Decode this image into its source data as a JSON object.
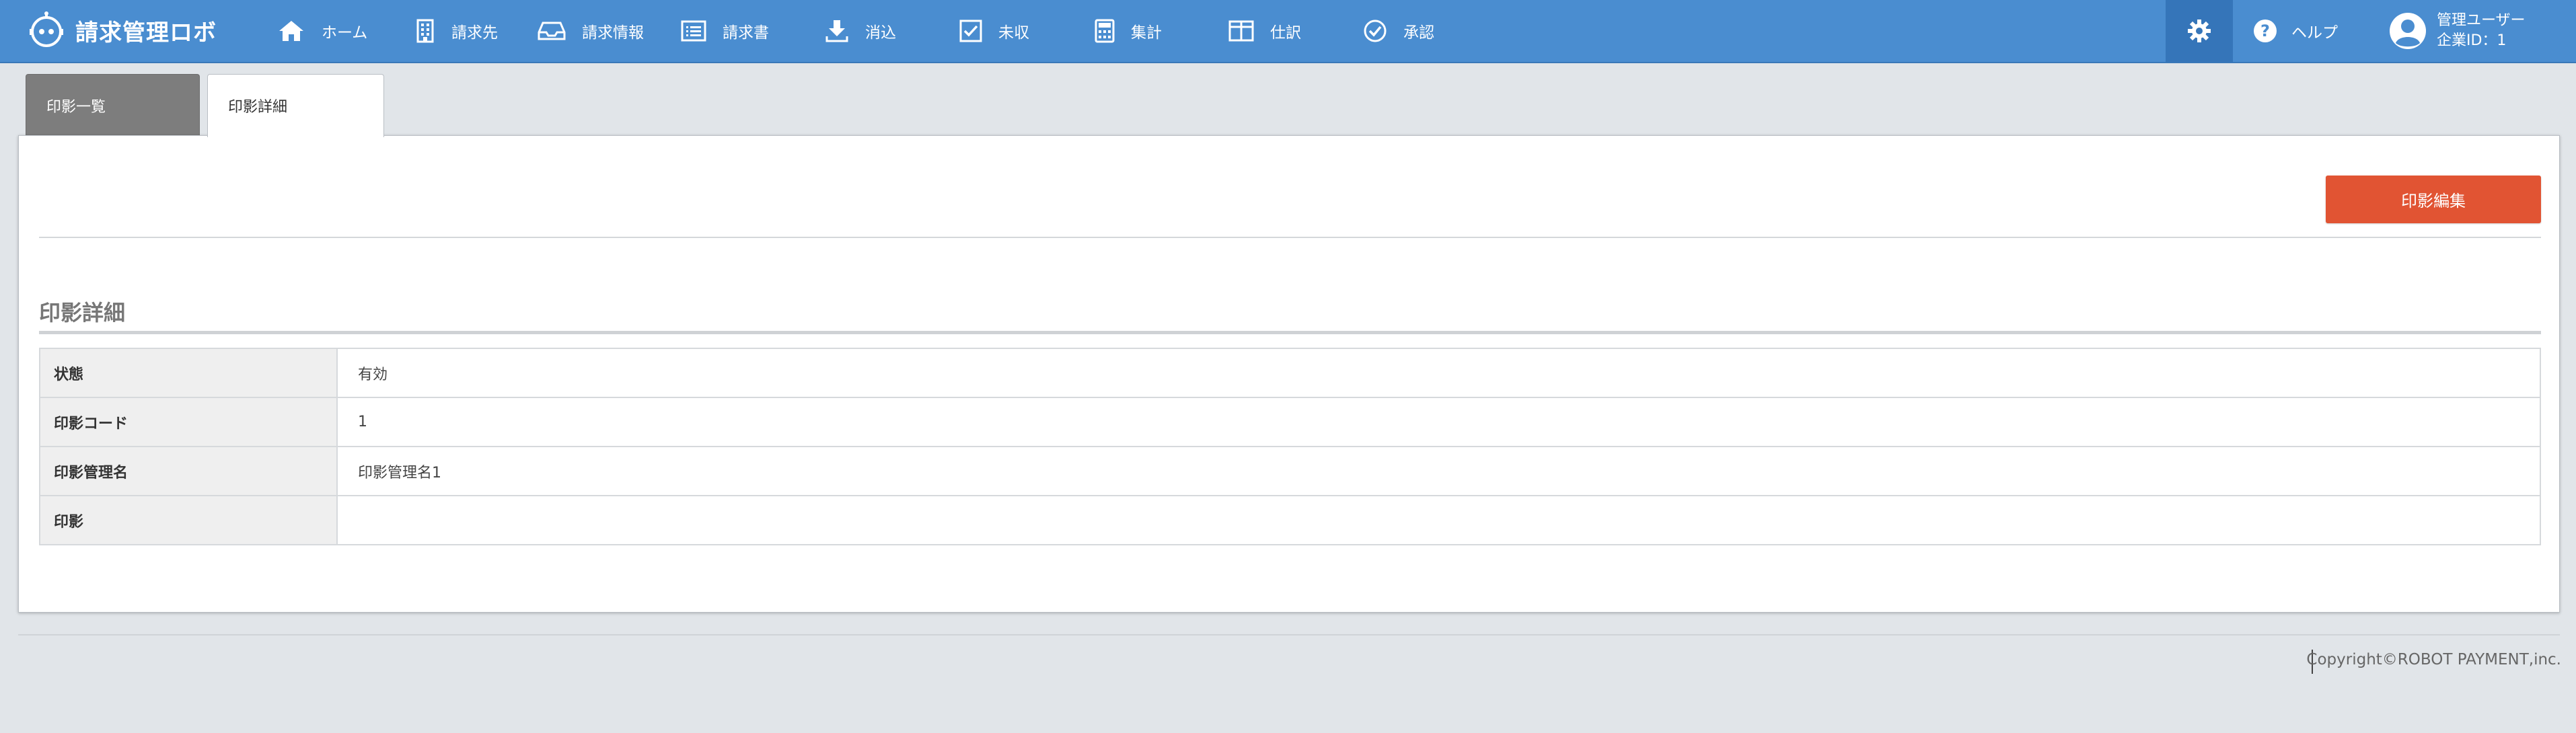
{
  "app": {
    "logo_text": "請求管理ロボ"
  },
  "nav": {
    "items": [
      {
        "label": "ホーム",
        "icon": "home-icon"
      },
      {
        "label": "請求先",
        "icon": "building-icon"
      },
      {
        "label": "請求情報",
        "icon": "inbox-icon"
      },
      {
        "label": "請求書",
        "icon": "list-icon"
      },
      {
        "label": "消込",
        "icon": "download-icon"
      },
      {
        "label": "未収",
        "icon": "checkbox-icon"
      },
      {
        "label": "集計",
        "icon": "calculator-icon"
      },
      {
        "label": "仕訳",
        "icon": "book-icon"
      },
      {
        "label": "承認",
        "icon": "check-circle-icon"
      }
    ],
    "settings_icon": "gear-icon",
    "help_label": "ヘルプ",
    "user": {
      "name": "管理ユーザー",
      "company": "企業ID：1"
    }
  },
  "tabs": [
    {
      "label": "印影一覧",
      "active": false
    },
    {
      "label": "印影詳細",
      "active": true
    }
  ],
  "detail": {
    "edit_button": "印影編集",
    "section_title": "印影詳細",
    "rows": [
      {
        "label": "状態",
        "value": "有効"
      },
      {
        "label": "印影コード",
        "value": "1"
      },
      {
        "label": "印影管理名",
        "value": "印影管理名1"
      },
      {
        "label": "印影",
        "value": ""
      }
    ]
  },
  "footer": {
    "copyright": "Copyright©ROBOT PAYMENT,inc."
  },
  "colors": {
    "nav_bg": "#4a8dd0",
    "nav_active_bg": "#3575b9",
    "edit_button": "#e15433",
    "inactive_tab": "#7d7d7d"
  }
}
